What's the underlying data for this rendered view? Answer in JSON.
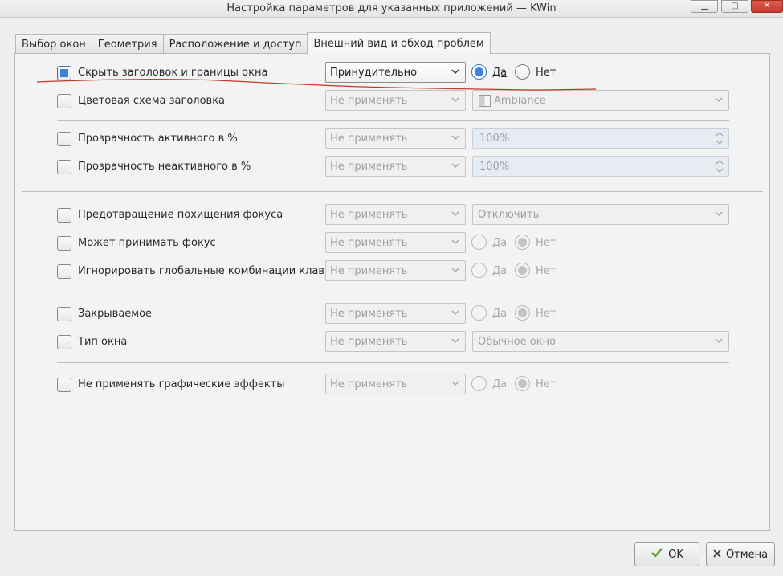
{
  "window": {
    "title": "Настройка параметров для указанных приложений — KWin",
    "controls": {
      "minimize": "▁",
      "maximize": "□",
      "close": "✕"
    }
  },
  "tabs": [
    {
      "label": "Выбор окон"
    },
    {
      "label": "Геометрия"
    },
    {
      "label": "Расположение и доступ"
    },
    {
      "label": "Внешний вид и обход проблем",
      "active": true
    }
  ],
  "rows": {
    "hide_titlebar": {
      "label": "Скрыть заголовок и границы окна",
      "checked": true,
      "policy": "Принудительно",
      "yes": "Да",
      "no": "Нет",
      "value": "Да"
    },
    "titlebar_color": {
      "label": "Цветовая схема заголовка",
      "checked": false,
      "policy": "Не применять",
      "value": "Ambiance"
    },
    "active_opacity": {
      "label": "Прозрачность активного в %",
      "checked": false,
      "policy": "Не применять",
      "value": "100%"
    },
    "inactive_opacity": {
      "label": "Прозрачность неактивного в %",
      "checked": false,
      "policy": "Не применять",
      "value": "100%"
    },
    "focus_stealing": {
      "label": "Предотвращение похищения фокуса",
      "checked": false,
      "policy": "Не применять",
      "value": "Отключить"
    },
    "accept_focus": {
      "label": "Может принимать фокус",
      "checked": false,
      "policy": "Не применять",
      "yes": "Да",
      "no": "Нет",
      "value": "Нет"
    },
    "ignore_shortcuts": {
      "label": "Игнорировать глобальные комбинации клавиш",
      "checked": false,
      "policy": "Не применять",
      "yes": "Да",
      "no": "Нет",
      "value": "Нет"
    },
    "closeable": {
      "label": "Закрываемое",
      "checked": false,
      "policy": "Не применять",
      "yes": "Да",
      "no": "Нет",
      "value": "Нет"
    },
    "window_type": {
      "label": "Тип окна",
      "checked": false,
      "policy": "Не применять",
      "value": "Обычное окно"
    },
    "no_effects": {
      "label": "Не применять графические эффекты",
      "checked": false,
      "policy": "Не применять",
      "yes": "Да",
      "no": "Нет",
      "value": "Нет"
    }
  },
  "buttons": {
    "ok": "OK",
    "cancel": "Отмена"
  },
  "colors": {
    "accent": "#3a84e0",
    "annotation": "#c0392b"
  }
}
